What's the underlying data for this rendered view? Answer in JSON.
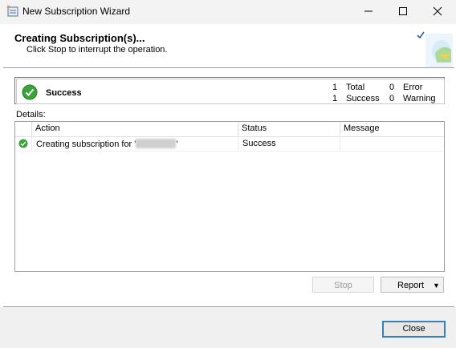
{
  "window": {
    "title": "New Subscription Wizard",
    "controls": {
      "minimize": "minimize-icon",
      "maximize": "maximize-icon",
      "close": "close-icon"
    }
  },
  "header": {
    "title": "Creating Subscription(s)...",
    "subtitle": "Click Stop to interrupt the operation."
  },
  "summary": {
    "status": "Success",
    "total_count": "1",
    "total_label": "Total",
    "success_count": "1",
    "success_label": "Success",
    "error_count": "0",
    "error_label": "Error",
    "warning_count": "0",
    "warning_label": "Warning"
  },
  "details": {
    "label": "Details:",
    "columns": [
      "Action",
      "Status",
      "Message"
    ],
    "rows": [
      {
        "action_prefix": "Creating subscription for '",
        "action_suffix": "'",
        "status": "Success",
        "message": ""
      }
    ]
  },
  "buttons": {
    "stop": "Stop",
    "report": "Report",
    "close": "Close"
  },
  "colors": {
    "success_green": "#3aa33a",
    "accent_blue": "#3c7fb1"
  }
}
